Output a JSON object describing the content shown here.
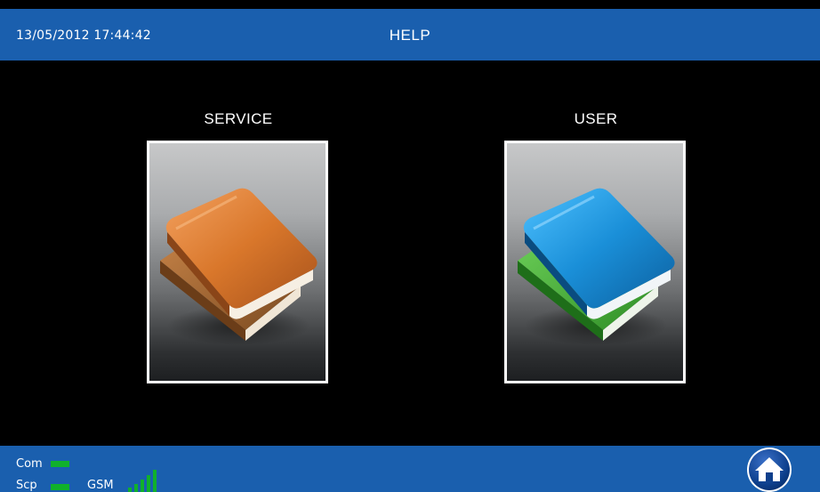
{
  "header": {
    "datetime": "13/05/2012 17:44:42",
    "title": "HELP"
  },
  "books": [
    {
      "label": "SERVICE",
      "icon": "orange-book-icon",
      "color": "#d9772b"
    },
    {
      "label": "USER",
      "icon": "blue-book-icon",
      "color": "#1a8fd8"
    }
  ],
  "status": {
    "com_label": "Com",
    "scp_label": "Scp",
    "gsm_label": "GSM",
    "led_color": "#10b12b",
    "gsm_signal_bars": 5
  },
  "home": {
    "icon": "home-icon"
  },
  "colors": {
    "bar": "#1a5fae",
    "background": "#000000"
  }
}
